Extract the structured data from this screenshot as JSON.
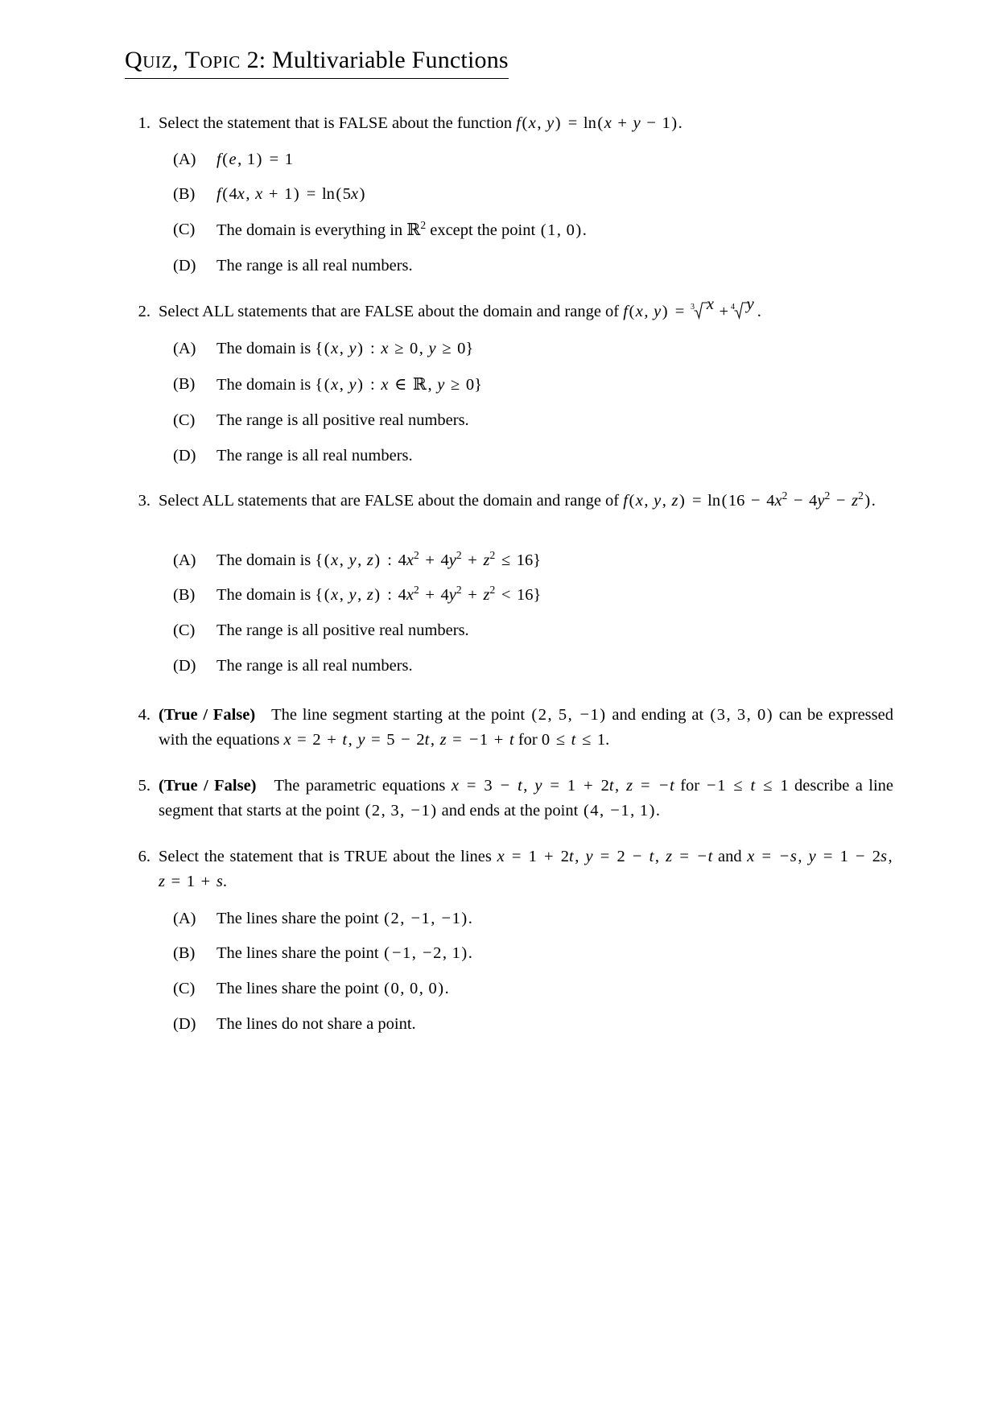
{
  "document": {
    "title_smallcaps": "Quiz, Topic",
    "title_number": "2",
    "title_rest": ": Multivariable Functions"
  },
  "questions": [
    {
      "number": "1.",
      "stem_prefix": "Select the statement that is FALSE about the function",
      "stem_math": "f(x, y) = ln(x + y − 1).",
      "choices": [
        {
          "label": "(A)",
          "text": "f(e, 1) = 1"
        },
        {
          "label": "(B)",
          "text": "f(4x, x + 1) = ln(5x)"
        },
        {
          "label": "(C)",
          "text": "The domain is everything in R² except the point (1, 0)."
        },
        {
          "label": "(D)",
          "text": "The range is all real numbers."
        }
      ]
    },
    {
      "number": "2.",
      "stem_prefix": "Select ALL statements that are FALSE about the domain and range of",
      "stem_math": "f(x, y) = ∛ x + ∜ y.",
      "choices": [
        {
          "label": "(A)",
          "text": "The domain is {(x, y) : x ≥ 0, y ≥ 0}"
        },
        {
          "label": "(B)",
          "text": "The domain is {(x, y) : x ∈ R, y ≥ 0}"
        },
        {
          "label": "(C)",
          "text": "The range is all positive real numbers."
        },
        {
          "label": "(D)",
          "text": "The range is all real numbers."
        }
      ]
    },
    {
      "number": "3.",
      "stem_prefix": "Select ALL statements that are FALSE about the domain and range of",
      "stem_math": "f(x, y, z) = ln(16 − 4x² − 4y² − z²).",
      "choices": [
        {
          "label": "(A)",
          "text": "The domain is {(x, y, z) : 4x² + 4y² + z² ≤ 16}"
        },
        {
          "label": "(B)",
          "text": "The domain is {(x, y, z) : 4x² + 4y² + z² < 16}"
        },
        {
          "label": "(C)",
          "text": "The range is all positive real numbers."
        },
        {
          "label": "(D)",
          "text": "The range is all real numbers."
        }
      ]
    },
    {
      "number": "4.",
      "tf_label": "(True / False)",
      "stem_math": "The line segment starting at the point (2, 5, −1) and ending at (3, 3, 0) can be expressed with the equations x = 2 + t, y = 5 − 2t, z = −1 + t for 0 ≤ t ≤ 1.",
      "choices": []
    },
    {
      "number": "5.",
      "tf_label": "(True / False)",
      "stem_math": "The parametric equations x = 3 − t, y = 1 + 2t, z = −t for −1 ≤ t ≤ 1 describe a line segment that starts at the point (2, 3, −1) and ends at the point (4, −1, 1).",
      "choices": []
    },
    {
      "number": "6.",
      "stem_prefix": "Select the statement that is TRUE about the lines",
      "stem_math": "x = 1 + 2t, y = 2 − t, z = −t and x = −s, y = 1 − 2s, z = 1 + s.",
      "choices": [
        {
          "label": "(A)",
          "text": "The lines share the point (2, −1, −1)."
        },
        {
          "label": "(B)",
          "text": "The lines share the point (−1, −2, 1)."
        },
        {
          "label": "(C)",
          "text": "The lines share the point (0, 0, 0)."
        },
        {
          "label": "(D)",
          "text": "The lines do not share a point."
        }
      ]
    }
  ]
}
